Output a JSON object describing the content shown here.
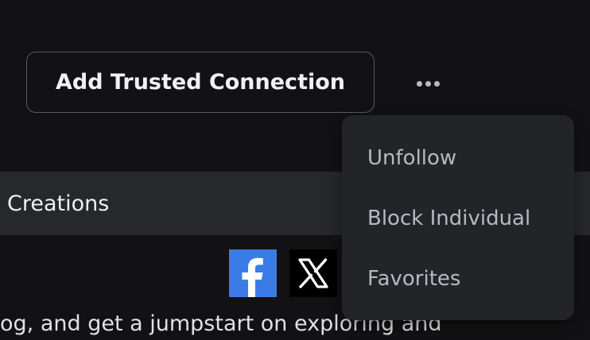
{
  "profile_actions": {
    "add_connection_label": "Add Trusted Connection",
    "more_icon": "more-horizontal-icon"
  },
  "tabs": {
    "active_label": "Creations"
  },
  "share": {
    "facebook_icon": "facebook-icon",
    "x_icon": "x-icon",
    "facebook_color": "#3b7be8",
    "x_color": "#000000"
  },
  "about": {
    "text_fragment": "og, and get a jumpstart on exploring and"
  },
  "menu": {
    "items": [
      {
        "label": "Unfollow"
      },
      {
        "label": "Block Individual"
      },
      {
        "label": "Favorites"
      }
    ]
  }
}
